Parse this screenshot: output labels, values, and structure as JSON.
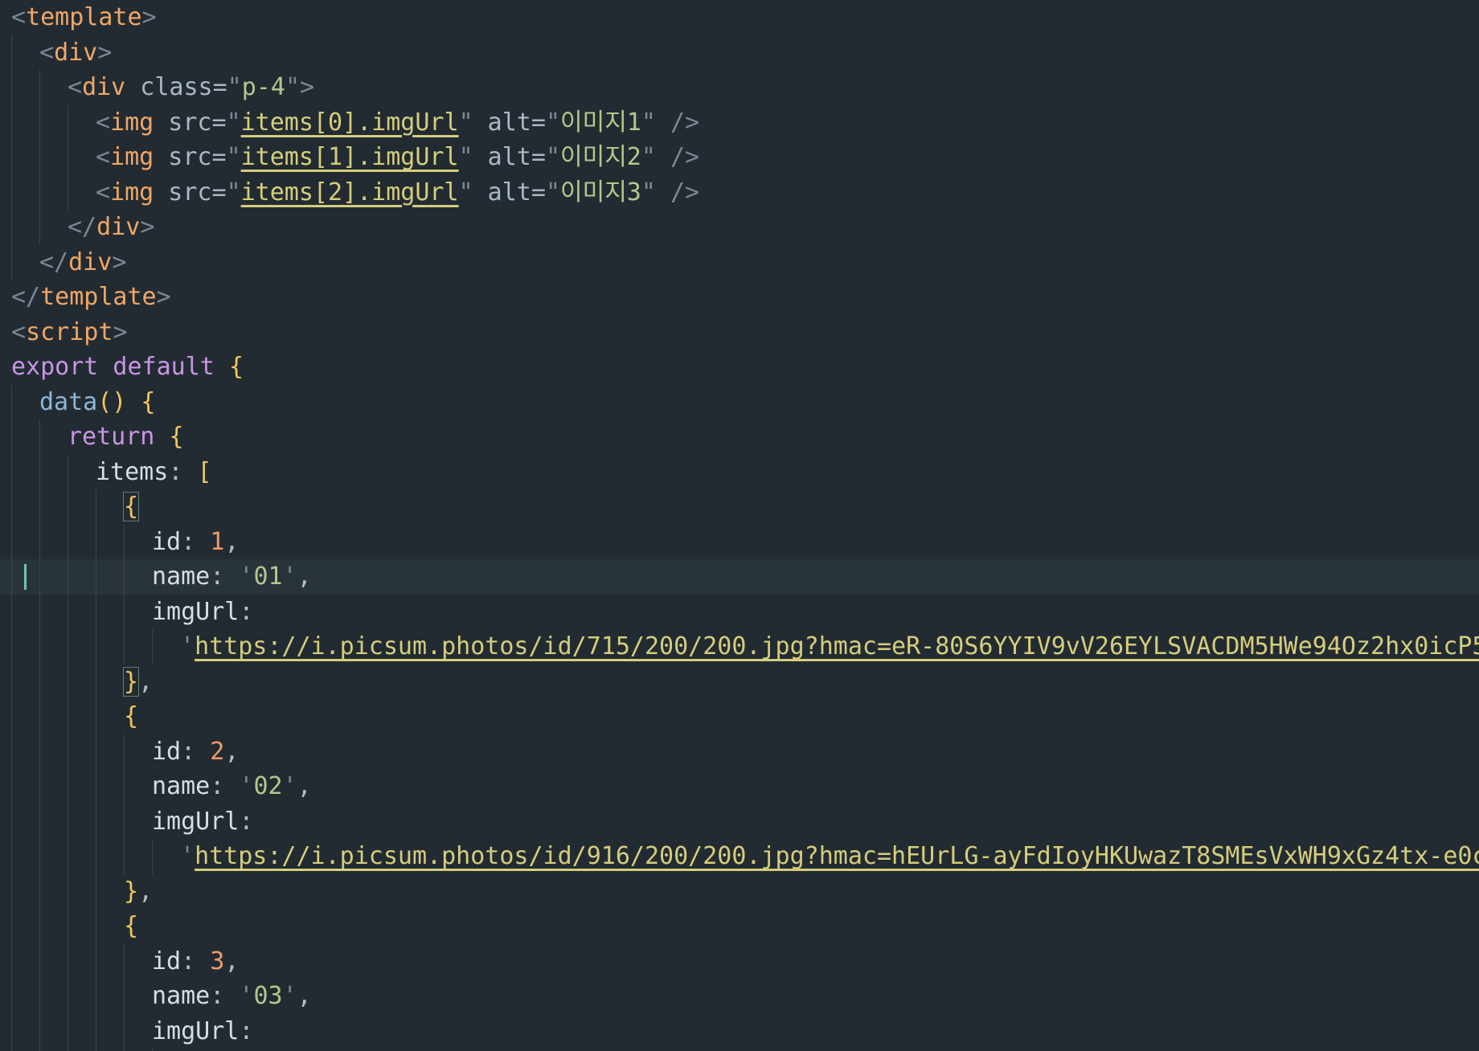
{
  "editor": {
    "active_line": 16,
    "lines": [
      {
        "indent": 0,
        "tokens": [
          [
            "br",
            "<"
          ],
          [
            "tag",
            "template"
          ],
          [
            "br",
            ">"
          ]
        ]
      },
      {
        "indent": 1,
        "tokens": [
          [
            "br",
            "<"
          ],
          [
            "tag",
            "div"
          ],
          [
            "br",
            ">"
          ]
        ]
      },
      {
        "indent": 2,
        "tokens": [
          [
            "br",
            "<"
          ],
          [
            "tag",
            "div"
          ],
          [
            "attr",
            " class="
          ],
          [
            "strq",
            "\""
          ],
          [
            "str",
            "p-4"
          ],
          [
            "strq",
            "\""
          ],
          [
            "br",
            ">"
          ]
        ]
      },
      {
        "indent": 3,
        "tokens": [
          [
            "br",
            "<"
          ],
          [
            "tag",
            "img"
          ],
          [
            "attr",
            " src="
          ],
          [
            "strq",
            "\""
          ],
          [
            "u",
            "items[0].imgUrl"
          ],
          [
            "strq",
            "\""
          ],
          [
            "attr",
            " alt="
          ],
          [
            "strq",
            "\""
          ],
          [
            "str",
            "이미지1"
          ],
          [
            "strq",
            "\""
          ],
          [
            "br",
            " />"
          ]
        ]
      },
      {
        "indent": 3,
        "tokens": [
          [
            "br",
            "<"
          ],
          [
            "tag",
            "img"
          ],
          [
            "attr",
            " src="
          ],
          [
            "strq",
            "\""
          ],
          [
            "u",
            "items[1].imgUrl"
          ],
          [
            "strq",
            "\""
          ],
          [
            "attr",
            " alt="
          ],
          [
            "strq",
            "\""
          ],
          [
            "str",
            "이미지2"
          ],
          [
            "strq",
            "\""
          ],
          [
            "br",
            " />"
          ]
        ]
      },
      {
        "indent": 3,
        "tokens": [
          [
            "br",
            "<"
          ],
          [
            "tag",
            "img"
          ],
          [
            "attr",
            " src="
          ],
          [
            "strq",
            "\""
          ],
          [
            "u",
            "items[2].imgUrl"
          ],
          [
            "strq",
            "\""
          ],
          [
            "attr",
            " alt="
          ],
          [
            "strq",
            "\""
          ],
          [
            "str",
            "이미지3"
          ],
          [
            "strq",
            "\""
          ],
          [
            "br",
            " />"
          ]
        ]
      },
      {
        "indent": 2,
        "tokens": [
          [
            "br",
            "</"
          ],
          [
            "tag",
            "div"
          ],
          [
            "br",
            ">"
          ]
        ]
      },
      {
        "indent": 1,
        "tokens": [
          [
            "br",
            "</"
          ],
          [
            "tag",
            "div"
          ],
          [
            "br",
            ">"
          ]
        ]
      },
      {
        "indent": 0,
        "tokens": [
          [
            "br",
            "</"
          ],
          [
            "tag",
            "template"
          ],
          [
            "br",
            ">"
          ]
        ]
      },
      {
        "indent": 0,
        "tokens": [
          [
            "br",
            "<"
          ],
          [
            "tag",
            "script"
          ],
          [
            "br",
            ">"
          ]
        ]
      },
      {
        "indent": 0,
        "tokens": [
          [
            "kw",
            "export default "
          ],
          [
            "brace",
            "{"
          ]
        ]
      },
      {
        "indent": 1,
        "tokens": [
          [
            "fn",
            "data"
          ],
          [
            "brace",
            "() {"
          ]
        ]
      },
      {
        "indent": 2,
        "tokens": [
          [
            "kw",
            "return "
          ],
          [
            "brace",
            "{"
          ]
        ]
      },
      {
        "indent": 3,
        "tokens": [
          [
            "prop",
            "items"
          ],
          [
            "punc",
            ": "
          ],
          [
            "brace",
            "["
          ]
        ]
      },
      {
        "indent": 4,
        "tokens": [
          [
            "brace-hl",
            "{"
          ]
        ]
      },
      {
        "indent": 5,
        "tokens": [
          [
            "prop",
            "id"
          ],
          [
            "punc",
            ": "
          ],
          [
            "num",
            "1"
          ],
          [
            "punc",
            ","
          ]
        ]
      },
      {
        "indent": 5,
        "tokens": [
          [
            "prop",
            "name"
          ],
          [
            "punc",
            ": "
          ],
          [
            "strq",
            "'"
          ],
          [
            "str",
            "01"
          ],
          [
            "strq",
            "'"
          ],
          [
            "punc",
            ","
          ]
        ]
      },
      {
        "indent": 5,
        "tokens": [
          [
            "prop",
            "imgUrl"
          ],
          [
            "punc",
            ":"
          ]
        ]
      },
      {
        "indent": 6,
        "tokens": [
          [
            "strq",
            "'"
          ],
          [
            "u",
            "https://i.picsum.photos/id/715/200/200.jpg?hmac=eR-80S6YYIV9vV26EYLSVACDM5HWe94Oz2hx0icP5vI"
          ],
          [
            "strq",
            "'"
          ]
        ]
      },
      {
        "indent": 4,
        "tokens": [
          [
            "brace-hl",
            "}"
          ],
          [
            "punc",
            ","
          ]
        ]
      },
      {
        "indent": 4,
        "tokens": [
          [
            "brace",
            "{"
          ]
        ]
      },
      {
        "indent": 5,
        "tokens": [
          [
            "prop",
            "id"
          ],
          [
            "punc",
            ": "
          ],
          [
            "num",
            "2"
          ],
          [
            "punc",
            ","
          ]
        ]
      },
      {
        "indent": 5,
        "tokens": [
          [
            "prop",
            "name"
          ],
          [
            "punc",
            ": "
          ],
          [
            "strq",
            "'"
          ],
          [
            "str",
            "02"
          ],
          [
            "strq",
            "'"
          ],
          [
            "punc",
            ","
          ]
        ]
      },
      {
        "indent": 5,
        "tokens": [
          [
            "prop",
            "imgUrl"
          ],
          [
            "punc",
            ":"
          ]
        ]
      },
      {
        "indent": 6,
        "tokens": [
          [
            "strq",
            "'"
          ],
          [
            "u",
            "https://i.picsum.photos/id/916/200/200.jpg?hmac=hEUrLG-ayFdIoyHKUwazT8SMEsVxWH9xGz4tx-e0cN0"
          ],
          [
            "strq",
            "'"
          ]
        ]
      },
      {
        "indent": 4,
        "tokens": [
          [
            "brace",
            "}"
          ],
          [
            "punc",
            ","
          ]
        ]
      },
      {
        "indent": 4,
        "tokens": [
          [
            "brace",
            "{"
          ]
        ]
      },
      {
        "indent": 5,
        "tokens": [
          [
            "prop",
            "id"
          ],
          [
            "punc",
            ": "
          ],
          [
            "num",
            "3"
          ],
          [
            "punc",
            ","
          ]
        ]
      },
      {
        "indent": 5,
        "tokens": [
          [
            "prop",
            "name"
          ],
          [
            "punc",
            ": "
          ],
          [
            "strq",
            "'"
          ],
          [
            "str",
            "03"
          ],
          [
            "strq",
            "'"
          ],
          [
            "punc",
            ","
          ]
        ]
      },
      {
        "indent": 5,
        "tokens": [
          [
            "prop",
            "imgUrl"
          ],
          [
            "punc",
            ":"
          ]
        ]
      },
      {
        "indent": 6,
        "tokens": [
          [
            "strq",
            "'"
          ],
          [
            "u",
            "https://i.picsum.photos/id/273/200/200.jpg?hmac=..."
          ],
          [
            "strq",
            "'"
          ]
        ]
      }
    ]
  }
}
